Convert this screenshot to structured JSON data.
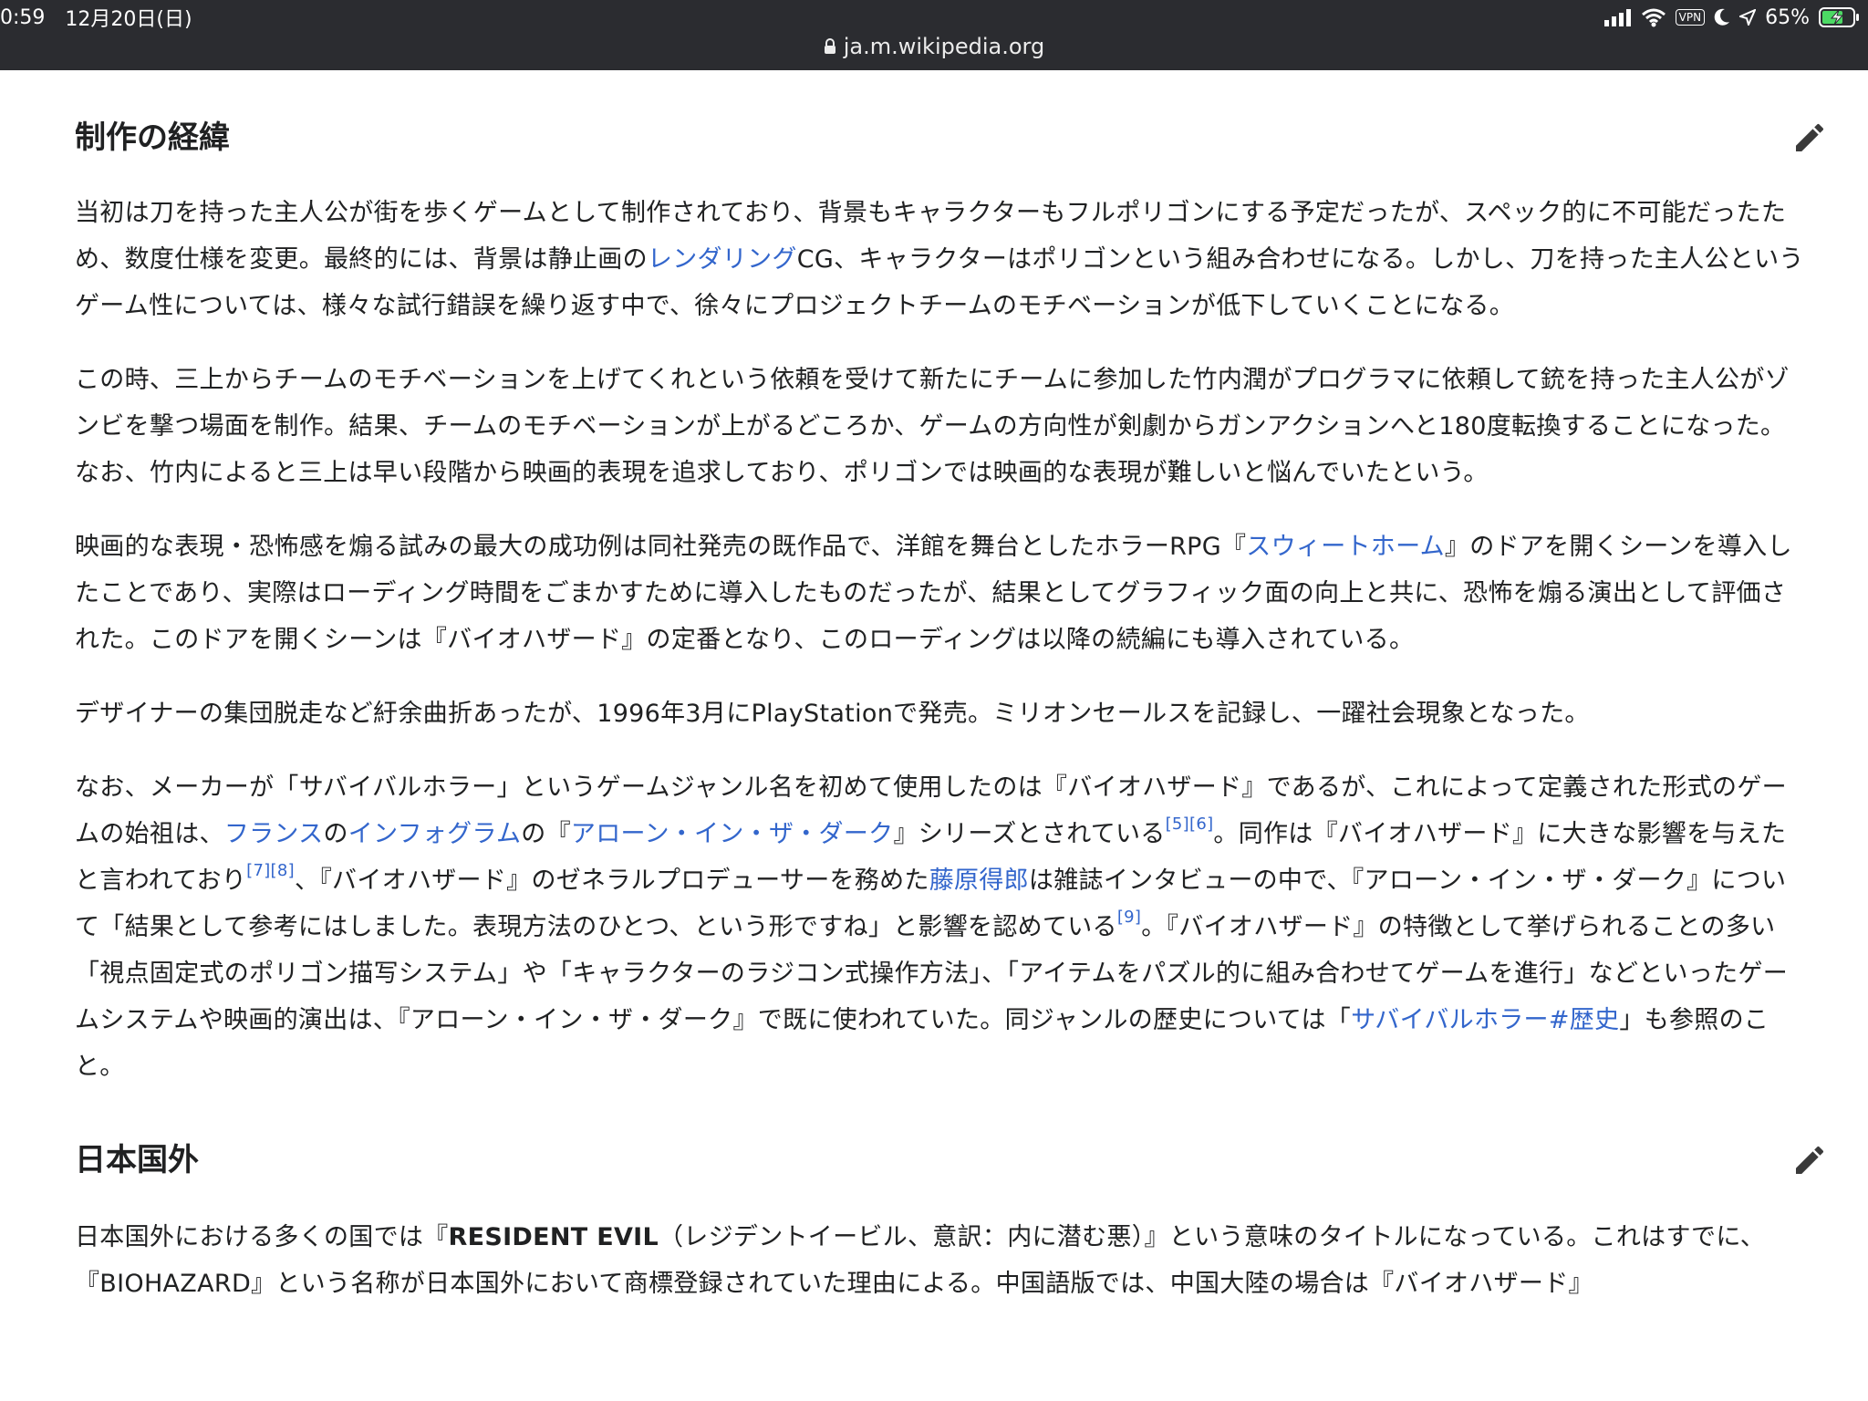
{
  "status": {
    "time": "0:59",
    "date": "12月20日(日)",
    "vpn": "VPN",
    "battery": "65%"
  },
  "browser": {
    "url": "ja.m.wikipedia.org"
  },
  "sections": [
    {
      "heading": "制作の経緯",
      "p1": {
        "a": "当初は刀を持った主人公が街を歩くゲームとして制作されており、背景もキャラクターもフルポリゴンにする予定だったが、スペック的に不可能だったため、数度仕様を変更。最終的には、背景は静止画の",
        "link": "レンダリング",
        "b": "CG、キャラクターはポリゴンという組み合わせになる。しかし、刀を持った主人公というゲーム性については、様々な試行錯誤を繰り返す中で、徐々にプロジェクトチームのモチベーションが低下していくことになる。"
      },
      "p2": "この時、三上からチームのモチベーションを上げてくれという依頼を受けて新たにチームに参加した竹内潤がプログラマに依頼して銃を持った主人公がゾンビを撃つ場面を制作。結果、チームのモチベーションが上がるどころか、ゲームの方向性が剣劇からガンアクションへと180度転換することになった。なお、竹内によると三上は早い段階から映画的表現を追求しており、ポリゴンでは映画的な表現が難しいと悩んでいたという。",
      "p3": {
        "a": "映画的な表現・恐怖感を煽る試みの最大の成功例は同社発売の既作品で、洋館を舞台としたホラーRPG『",
        "link": "スウィートホーム",
        "b": "』のドアを開くシーンを導入したことであり、実際はローディング時間をごまかすために導入したものだったが、結果としてグラフィック面の向上と共に、恐怖を煽る演出として評価された。このドアを開くシーンは『バイオハザード』の定番となり、このローディングは以降の続編にも導入されている。"
      },
      "p4": "デザイナーの集団脱走など紆余曲折あったが、1996年3月にPlayStationで発売。ミリオンセールスを記録し、一躍社会現象となった。",
      "p5": {
        "a": "なお、メーカーが「サバイバルホラー」というゲームジャンル名を初めて使用したのは『バイオハザード』であるが、これによって定義された形式のゲームの始祖は、",
        "link1": "フランス",
        "b": "の",
        "link2": "インフォグラム",
        "c": "の『",
        "link3": "アローン・イン・ザ・ダーク",
        "d": "』シリーズとされている",
        "ref1": "[5]",
        "ref2": "[6]",
        "e": "。同作は『バイオハザード』に大きな影響を与えたと言われており",
        "ref3": "[7]",
        "ref4": "[8]",
        "f": "、『バイオハザード』のゼネラルプロデューサーを務めた",
        "link4": "藤原得郎",
        "g": "は雑誌インタビューの中で、『アローン・イン・ザ・ダーク』について「結果として参考にはしました。表現方法のひとつ、という形ですね」と影響を認めている",
        "ref5": "[9]",
        "h": "。『バイオハザード』の特徴として挙げられることの多い「視点固定式のポリゴン描写システム」や「キャラクターのラジコン式操作方法」、「アイテムをパズル的に組み合わせてゲームを進行」などといったゲームシステムや映画的演出は、『アローン・イン・ザ・ダーク』で既に使われていた。同ジャンルの歴史については「",
        "link5": "サバイバルホラー#歴史",
        "i": "」も参照のこと。"
      }
    },
    {
      "heading": "日本国外",
      "p1": {
        "a": "日本国外における多くの国では『",
        "bold": "RESIDENT EVIL",
        "b": "（レジデントイービル、意訳：内に潜む悪）』という意味のタイトルになっている。これはすでに、『BIOHAZARD』という名称が日本国外において商標登録されていた理由による。中国語版では、中国大陸の場合は『バイオハザード』"
      }
    }
  ]
}
